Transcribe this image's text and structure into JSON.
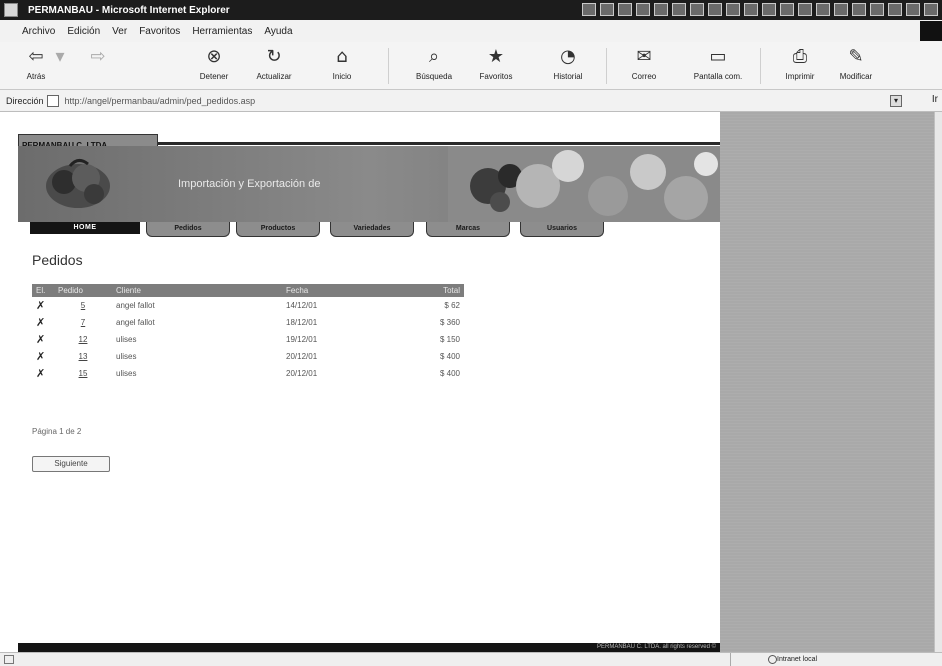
{
  "window": {
    "title": "PERMANBAU - Microsoft Internet Explorer"
  },
  "menu": [
    "Archivo",
    "Edición",
    "Ver",
    "Favoritos",
    "Herramientas",
    "Ayuda"
  ],
  "toolbar": {
    "back": "Atrás",
    "stop": "Detener",
    "refresh": "Actualizar",
    "home": "Inicio",
    "search": "Búsqueda",
    "favorites": "Favoritos",
    "history": "Historial",
    "mail": "Correo",
    "fullscreen": "Pantalla com.",
    "print": "Imprimir",
    "edit": "Modificar"
  },
  "address": {
    "label": "Dirección",
    "url": "http://angel/permanbau/admin/ped_pedidos.asp",
    "go": "Ir"
  },
  "site": {
    "brand": "PERMANBAU C. LTDA.",
    "slogan": "Importación y Exportación de",
    "nav": {
      "home": "HOME",
      "tabs": [
        "Pedidos",
        "Productos",
        "Variedades",
        "Marcas",
        "Usuarios"
      ]
    },
    "footer": "PERMANBAU C. LTDA. all rights reserved ©"
  },
  "orders": {
    "title": "Pedidos",
    "columns": [
      "El.",
      "Pedido",
      "Cliente",
      "Fecha",
      "Total"
    ],
    "rows": [
      {
        "id": "5",
        "client": "angel fallot",
        "date": "14/12/01",
        "total": "$ 62"
      },
      {
        "id": "7",
        "client": "angel fallot",
        "date": "18/12/01",
        "total": "$ 360"
      },
      {
        "id": "12",
        "client": "ulises",
        "date": "19/12/01",
        "total": "$ 150"
      },
      {
        "id": "13",
        "client": "ulises",
        "date": "20/12/01",
        "total": "$ 400"
      },
      {
        "id": "15",
        "client": "ulises",
        "date": "20/12/01",
        "total": "$ 400"
      }
    ],
    "page_info": "Página 1 de 2",
    "next_label": "Siguiente"
  },
  "status": {
    "zone": "Intranet local"
  }
}
